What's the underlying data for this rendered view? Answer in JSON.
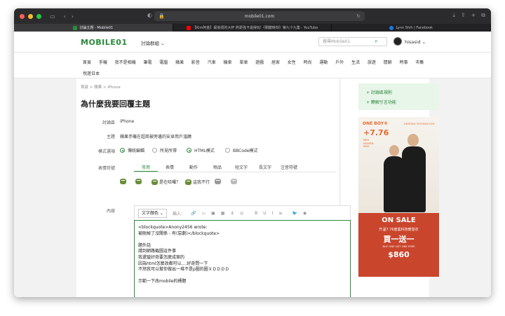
{
  "browser": {
    "url": "mobile01.com",
    "tabs": [
      {
        "label": "討論主題 - Mobile01",
        "favicon_color": "#2a8a3a"
      },
      {
        "label": "【Kim阿金】最後問的大杯 熱愛強卡還得玩!《關鍵時刻》第九十九集 - YouTube",
        "favicon_color": "#ff0000"
      },
      {
        "label": "Lynn Shih | Facebook",
        "favicon_color": "#1877f2"
      }
    ]
  },
  "site": {
    "logo": "MOBILE01",
    "forum_menu": "討論群組 ⌄",
    "search_placeholder": "搜尋Mobile01",
    "username": "hisasid ⌄"
  },
  "categories_row1": [
    "首頁",
    "手機",
    "我不是相機",
    "筆電",
    "電腦",
    "蘋果",
    "影音",
    "汽車",
    "機車",
    "單車",
    "遊戲",
    "居家",
    "女性",
    "時尚",
    "運動",
    "戶外",
    "生活",
    "旅遊",
    "閒聊",
    "時事",
    "市集"
  ],
  "categories_row2": [
    "悅遊日本"
  ],
  "breadcrumb": "首頁 > 蘋果 > iPhone",
  "page_title": "為什麼我要回覆主題",
  "form": {
    "forum_label": "討論區",
    "forum_value": "iPhone",
    "subject_label": "主題",
    "subject_value": "蘋果手機在超商被旁邊的安卓用戶溫饒",
    "mode_label": "模式選項",
    "modes": [
      {
        "label": "傳統編輯",
        "checked": true
      },
      {
        "label": "所見所得",
        "checked": false
      },
      {
        "label": "HTML模式",
        "checked": true
      },
      {
        "label": "BBCode模式",
        "checked": false
      }
    ],
    "emoji_label": "表情符號",
    "emoji_tabs": [
      "常用",
      "表情",
      "動作",
      "物品",
      "短文字",
      "長文字",
      "注音符號"
    ],
    "emoji_items": [
      "",
      "",
      "是在哈囉？",
      "這我不行",
      "",
      ""
    ],
    "content_label": "內容",
    "toolbar": {
      "color_button": "文字顏色 ⌄",
      "insert_label": "插入：",
      "tools": [
        "🔗",
        "▭",
        "▣",
        "▦",
        "⚓",
        "◎",
        "B",
        "U",
        "I",
        "≡",
        "🐦",
        "◉"
      ]
    },
    "content_lines": [
      "<blockquote>Anony2456 wrote:",
      " 被刪掉了沒關係 - 有(惡劇)</blockquote>",
      "",
      "題外話",
      "請到網路截圖這件事",
      "我還蠻好奇要怎麼成案的",
      "因為html怎麼改都可以....好奇問一下",
      "不然我可以幫你做出一堆不是p圖的圖ＸＤＤＤＤ",
      "",
      "示範一下改mobile的標題"
    ]
  },
  "sidebar": {
    "links": [
      "+ 討論區規則",
      "+ 瞭解引言功能"
    ]
  },
  "ad": {
    "brand": "ONE BOY®",
    "tag": "HEATING TECHNOLOGY",
    "price": "+7.76",
    "sub": "MEN\nWOMEN\nKIDS",
    "sale": "ON SALE",
    "sale_sub": "升溫7.76度黑科技暖發衣",
    "buy": "買一送一",
    "buy_en": "BUY ONE GET ONE FREE",
    "amount": "$860"
  },
  "colors": {
    "brand_green": "#2a8a3a",
    "ad_red": "#c9452c",
    "ad_orange": "#e8692d"
  }
}
